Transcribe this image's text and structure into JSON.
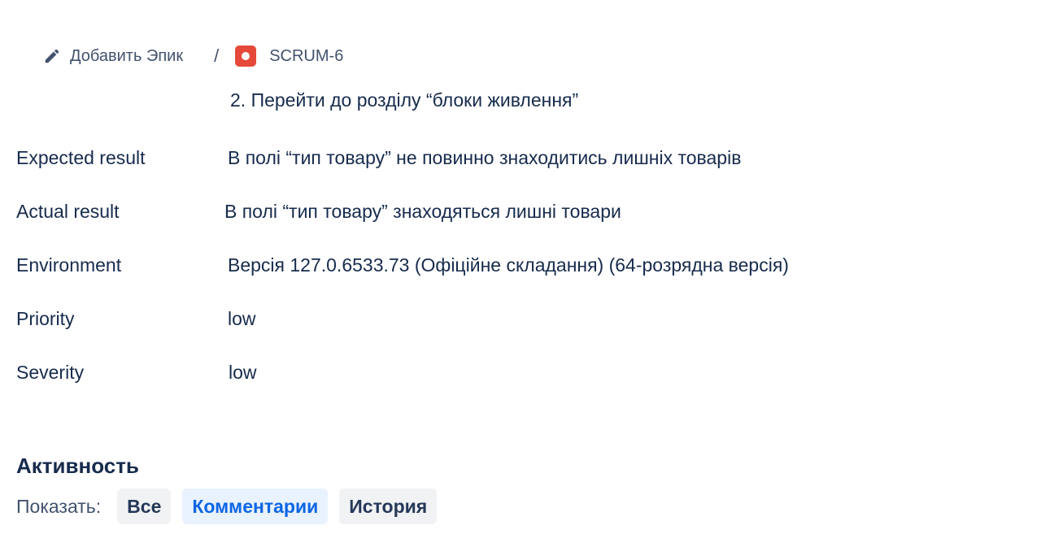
{
  "breadcrumb": {
    "add_epic_label": "Добавить Эпик",
    "add_epic_icon": "pencil-icon",
    "separator": "/",
    "issue_key": "SCRUM-6",
    "issue_type_icon": "bug-icon",
    "issue_type_color": "#e5493a"
  },
  "description": {
    "partial_step": "2. Перейти до розділу “блоки живлення”"
  },
  "fields": [
    {
      "label": "Expected result",
      "value": "В полі “тип товару” не повинно знаходитись лишніх товарів"
    },
    {
      "label": "Actual result",
      "value": "В полі “тип товару” знаходяться лишні товари"
    },
    {
      "label": "Environment",
      "value": "Версія 127.0.6533.73 (Офіційне складання) (64-розрядна версія)"
    },
    {
      "label": "Priority",
      "value": "low"
    },
    {
      "label": "Severity",
      "value": "low"
    }
  ],
  "activity": {
    "title": "Активность",
    "show_label": "Показать:",
    "filters": [
      {
        "label": "Все",
        "active": false
      },
      {
        "label": "Комментарии",
        "active": true
      },
      {
        "label": "История",
        "active": false
      }
    ],
    "active_color": "#0c66e4"
  }
}
